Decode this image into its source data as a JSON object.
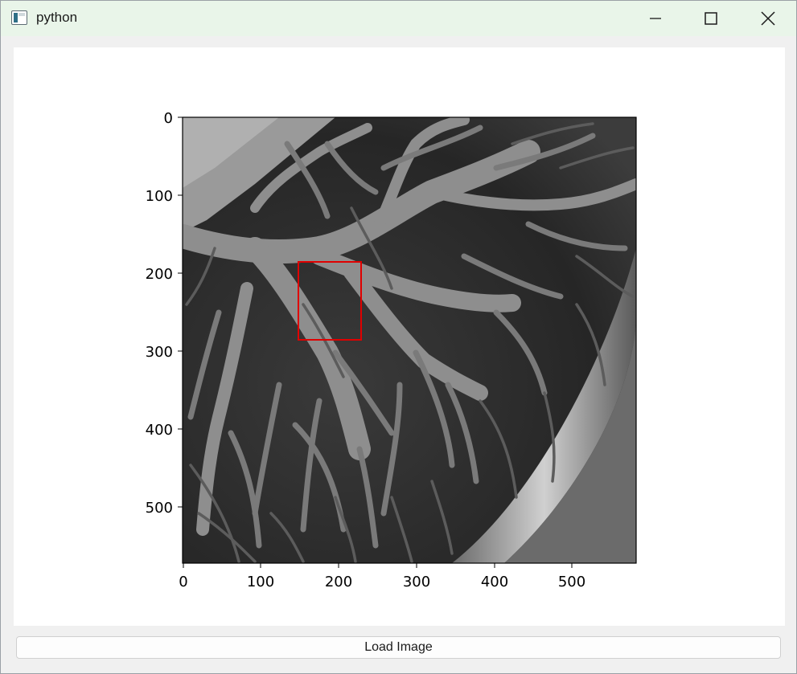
{
  "window": {
    "title": "python",
    "controls": {
      "minimize": "minimize-icon",
      "maximize": "maximize-icon",
      "close": "close-icon"
    }
  },
  "figure": {
    "image_description_name": "grayscale-vessel-image",
    "x_ticks": [
      "0",
      "100",
      "200",
      "300",
      "400",
      "500"
    ],
    "y_ticks": [
      "0",
      "100",
      "200",
      "300",
      "400",
      "500"
    ],
    "x_range": [
      0,
      580
    ],
    "y_range": [
      0,
      572
    ],
    "selection_rect": {
      "x0": 148,
      "y0": 185,
      "x1": 228,
      "y1": 285,
      "color": "#e00000"
    }
  },
  "footer": {
    "load_button_label": "Load Image"
  }
}
